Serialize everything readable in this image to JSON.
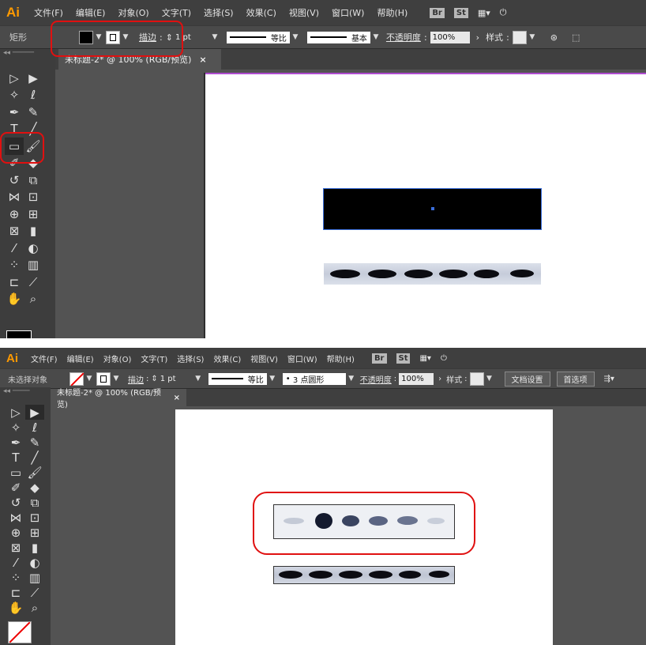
{
  "top": {
    "app_logo": "Ai",
    "menu": [
      "文件(F)",
      "编辑(E)",
      "对象(O)",
      "文字(T)",
      "选择(S)",
      "效果(C)",
      "视图(V)",
      "窗口(W)",
      "帮助(H)"
    ],
    "bridge_labels": [
      "Br",
      "St"
    ],
    "control": {
      "tool_name": "矩形",
      "stroke_label": "描边",
      "stroke_weight": "1 pt",
      "profile_label": "等比",
      "brush_label": "基本",
      "opacity_label": "不透明度",
      "opacity_value": "100%",
      "style_label": "样式"
    },
    "tab": {
      "title": "未标题-2* @ 100% (RGB/预览)",
      "close": "×"
    }
  },
  "bottom": {
    "app_logo": "Ai",
    "menu": [
      "文件(F)",
      "编辑(E)",
      "对象(O)",
      "文字(T)",
      "选择(S)",
      "效果(C)",
      "视图(V)",
      "窗口(W)",
      "帮助(H)"
    ],
    "bridge_labels": [
      "Br",
      "St"
    ],
    "control": {
      "tool_name": "未选择对象",
      "stroke_label": "描边",
      "stroke_weight": "1 pt",
      "profile_label": "等比",
      "brush_label": "3 点圆形",
      "opacity_label": "不透明度",
      "opacity_value": "100%",
      "style_label": "样式",
      "doc_setup": "文档设置",
      "prefs": "首选项"
    },
    "tab": {
      "title": "未标题-2* @ 100% (RGB/预览)",
      "close": "×"
    }
  },
  "colors": {
    "highlight": "#e01010",
    "ui_bg": "#535353",
    "menubar": "#3f3f3f",
    "logo": "#ff9a00"
  },
  "icons": [
    "selection-icon",
    "direct-selection-icon",
    "magic-wand-icon",
    "lasso-icon",
    "pen-icon",
    "curvature-icon",
    "type-icon",
    "line-icon",
    "rectangle-icon",
    "paintbrush-icon",
    "shaper-icon",
    "eraser-icon",
    "rotate-icon",
    "scale-icon",
    "width-icon",
    "free-transform-icon",
    "shape-builder-icon",
    "perspective-icon",
    "mesh-icon",
    "gradient-icon",
    "eyedropper-icon",
    "blend-icon",
    "symbol-sprayer-icon",
    "column-graph-icon",
    "artboard-icon",
    "slice-icon",
    "hand-icon",
    "zoom-icon"
  ]
}
